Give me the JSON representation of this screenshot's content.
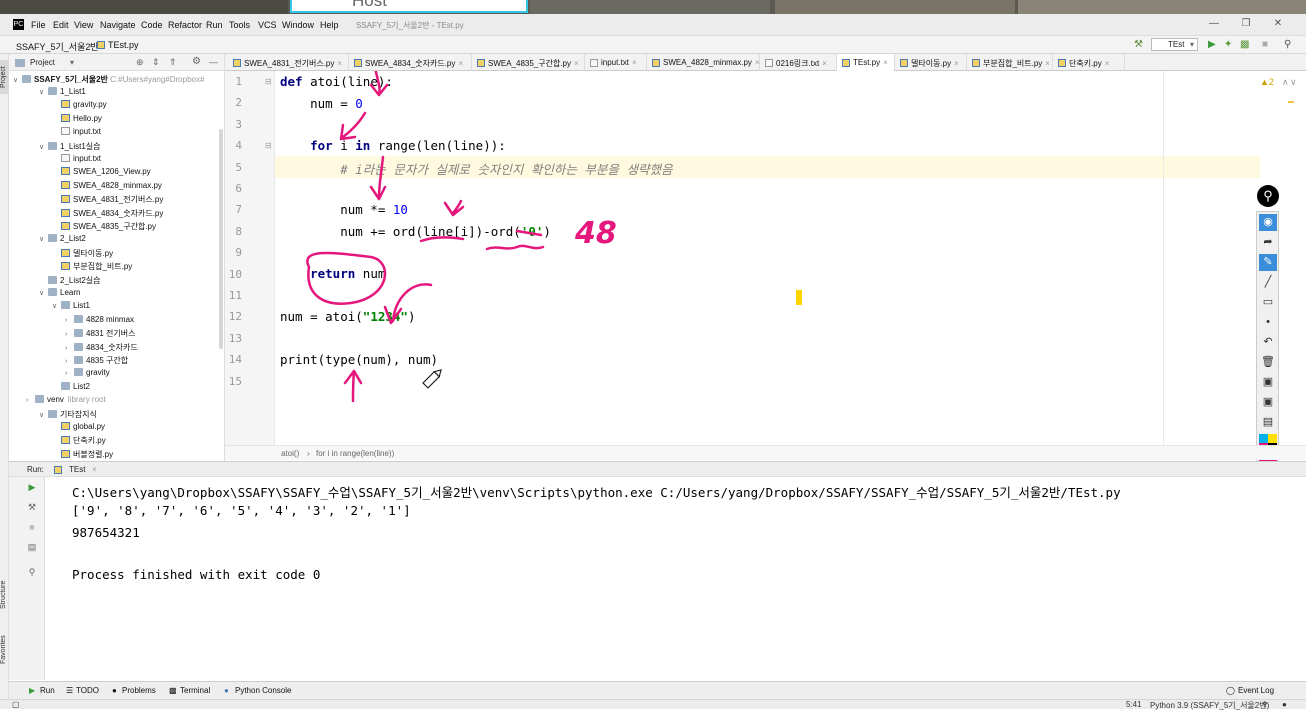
{
  "video": {
    "host_label": "Host"
  },
  "window": {
    "title": "SSAFY_5기_서울2반 - TEst.py",
    "menu": [
      "File",
      "Edit",
      "View",
      "Navigate",
      "Code",
      "Refactor",
      "Run",
      "Tools",
      "VCS",
      "Window",
      "Help"
    ]
  },
  "nav": {
    "project": "SSAFY_5기_서울2반",
    "file": "TEst.py",
    "run_config": "TEst"
  },
  "project_panel": {
    "title": "Project",
    "root": "SSAFY_5기_서울2반",
    "root_path": "C:#Users#yang#Dropbox#",
    "items": [
      {
        "label": "1_List1",
        "type": "folder",
        "depth": 1,
        "open": true
      },
      {
        "label": "gravity.py",
        "type": "py",
        "depth": 2
      },
      {
        "label": "Hello.py",
        "type": "py",
        "depth": 2
      },
      {
        "label": "input.txt",
        "type": "txt",
        "depth": 2
      },
      {
        "label": "1_List1실습",
        "type": "folder",
        "depth": 1,
        "open": true
      },
      {
        "label": "input.txt",
        "type": "txt",
        "depth": 2
      },
      {
        "label": "SWEA_1206_View.py",
        "type": "py",
        "depth": 2
      },
      {
        "label": "SWEA_4828_minmax.py",
        "type": "py",
        "depth": 2
      },
      {
        "label": "SWEA_4831_전기버스.py",
        "type": "py",
        "depth": 2
      },
      {
        "label": "SWEA_4834_숫자카드.py",
        "type": "py",
        "depth": 2
      },
      {
        "label": "SWEA_4835_구간합.py",
        "type": "py",
        "depth": 2
      },
      {
        "label": "2_List2",
        "type": "folder",
        "depth": 1,
        "open": true
      },
      {
        "label": "델타이동.py",
        "type": "py",
        "depth": 2
      },
      {
        "label": "부분집합_비트.py",
        "type": "py",
        "depth": 2
      },
      {
        "label": "2_List2실습",
        "type": "folder",
        "depth": 1,
        "open": false,
        "noarrow": true
      },
      {
        "label": "Learn",
        "type": "folder",
        "depth": 1,
        "open": true
      },
      {
        "label": "List1",
        "type": "folder",
        "depth": 2,
        "open": true
      },
      {
        "label": "4828 minmax",
        "type": "folder",
        "depth": 3,
        "open": false
      },
      {
        "label": "4831 전기버스",
        "type": "folder",
        "depth": 3,
        "open": false
      },
      {
        "label": "4834_숫자카드",
        "type": "folder",
        "depth": 3,
        "open": false
      },
      {
        "label": "4835 구간합",
        "type": "folder",
        "depth": 3,
        "open": false
      },
      {
        "label": "gravity",
        "type": "folder",
        "depth": 3,
        "open": false
      },
      {
        "label": "List2",
        "type": "folder",
        "depth": 2,
        "open": false,
        "noarrow": true
      },
      {
        "label": "venv",
        "type": "folder",
        "depth": 0,
        "open": false,
        "extra": "library root"
      },
      {
        "label": "기타잡지식",
        "type": "folder",
        "depth": 1,
        "open": true
      },
      {
        "label": "global.py",
        "type": "py",
        "depth": 2
      },
      {
        "label": "단축키.py",
        "type": "py",
        "depth": 2
      },
      {
        "label": "버블정렬.py",
        "type": "py",
        "depth": 2
      }
    ]
  },
  "tabs": [
    {
      "label": "SWEA_4831_전기버스.py",
      "type": "py"
    },
    {
      "label": "SWEA_4834_숫자카드.py",
      "type": "py"
    },
    {
      "label": "SWEA_4835_구간합.py",
      "type": "py"
    },
    {
      "label": "input.txt",
      "type": "txt"
    },
    {
      "label": "SWEA_4828_minmax.py",
      "type": "py"
    },
    {
      "label": "0216링크.txt",
      "type": "txt"
    },
    {
      "label": "TEst.py",
      "type": "py",
      "active": true
    },
    {
      "label": "델타이동.py",
      "type": "py"
    },
    {
      "label": "부분집합_비트.py",
      "type": "py"
    },
    {
      "label": "단축키.py",
      "type": "py"
    }
  ],
  "editor": {
    "line_numbers": [
      "1",
      "2",
      "3",
      "4",
      "5",
      "6",
      "7",
      "8",
      "9",
      "10",
      "11",
      "12",
      "13",
      "14",
      "15"
    ],
    "code": {
      "l1_kw": "def ",
      "l1_rest": "atoi(line):",
      "l2_a": "    num = ",
      "l2_num": "0",
      "l4_a": "    ",
      "l4_kw1": "for",
      "l4_b": " i ",
      "l4_kw2": "in",
      "l4_c": " range(len(line)):",
      "l5_indent": "        ",
      "l5_comment": "# i라는 문자가 실제로 숫자인지 확인하는 부분을 생략했음",
      "l7_a": "        num *= ",
      "l7_num": "10",
      "l8_a": "        num += ord(line[i])-ord(",
      "l8_str": "'0'",
      "l8_b": ")",
      "l10_a": "    ",
      "l10_kw": "return",
      "l10_b": " num",
      "l12_a": "num = atoi(",
      "l12_str": "\"1234\"",
      "l12_b": ")",
      "l14": "print(type(num), num)"
    },
    "handwritten_note": "48",
    "warning_count": "2"
  },
  "breadcrumb": [
    "atoi()",
    "for i in range(len(line))"
  ],
  "run_panel": {
    "label": "Run:",
    "tab": "TEst",
    "lines": [
      "C:\\Users\\yang\\Dropbox\\SSAFY\\SSAFY_수업\\SSAFY_5기_서울2반\\venv\\Scripts\\python.exe C:/Users/yang/Dropbox/SSAFY/SSAFY_수업/SSAFY_5기_서울2반/TEst.py",
      "['9', '8', '7', '6', '5', '4', '3', '2', '1']",
      "987654321",
      "",
      "Process finished with exit code 0"
    ]
  },
  "side_labels": {
    "project": "Project",
    "structure": "Structure",
    "favorites": "Favorites"
  },
  "bottom_tabs": [
    "Run",
    "TODO",
    "Problems",
    "Terminal",
    "Python Console"
  ],
  "event_log": "Event Log",
  "status": {
    "position": "5:41",
    "interpreter": "Python 3.9 (SSAFY_5기_서울2반)"
  },
  "colors": {
    "accent": "#3b8dd9",
    "annotation_pen": "#e5177d",
    "highlight_line": "#fffadf",
    "caret_mark": "#ffd500",
    "host_frame": "#35c6e8"
  }
}
